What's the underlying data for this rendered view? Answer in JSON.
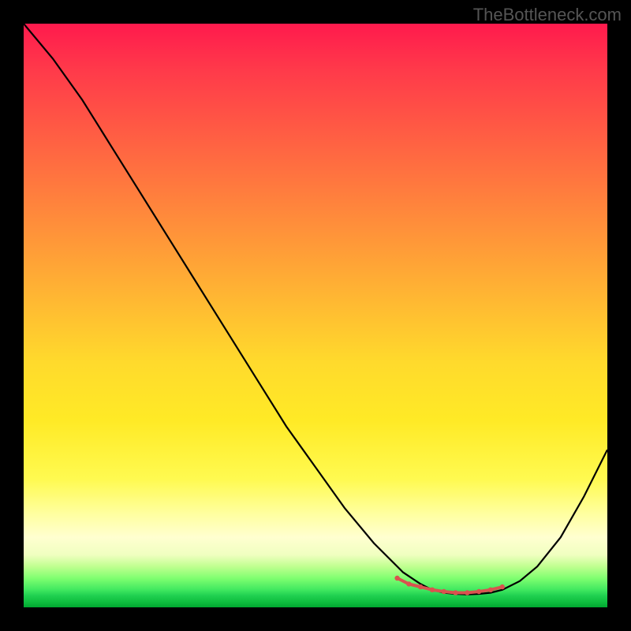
{
  "watermark": "TheBottleneck.com",
  "chart_data": {
    "type": "line",
    "title": "",
    "xlabel": "",
    "ylabel": "",
    "xlim": [
      0,
      100
    ],
    "ylim": [
      0,
      100
    ],
    "series": [
      {
        "name": "curve",
        "color": "#000000",
        "x": [
          0,
          5,
          10,
          15,
          20,
          25,
          30,
          35,
          40,
          45,
          50,
          55,
          60,
          65,
          68,
          70,
          72,
          74,
          76,
          78,
          80,
          82,
          85,
          88,
          92,
          96,
          100
        ],
        "y": [
          100,
          94,
          87,
          79,
          71,
          63,
          55,
          47,
          39,
          31,
          24,
          17,
          11,
          6,
          4,
          3,
          2.5,
          2.3,
          2.2,
          2.3,
          2.5,
          3,
          4.5,
          7,
          12,
          19,
          27
        ]
      },
      {
        "name": "highlight-valley",
        "color": "#d9534f",
        "style": "dotted",
        "x": [
          64,
          66,
          68,
          70,
          72,
          74,
          76,
          78,
          80,
          82
        ],
        "y": [
          5,
          4,
          3.5,
          3,
          2.7,
          2.5,
          2.5,
          2.7,
          3,
          3.5
        ]
      }
    ]
  }
}
